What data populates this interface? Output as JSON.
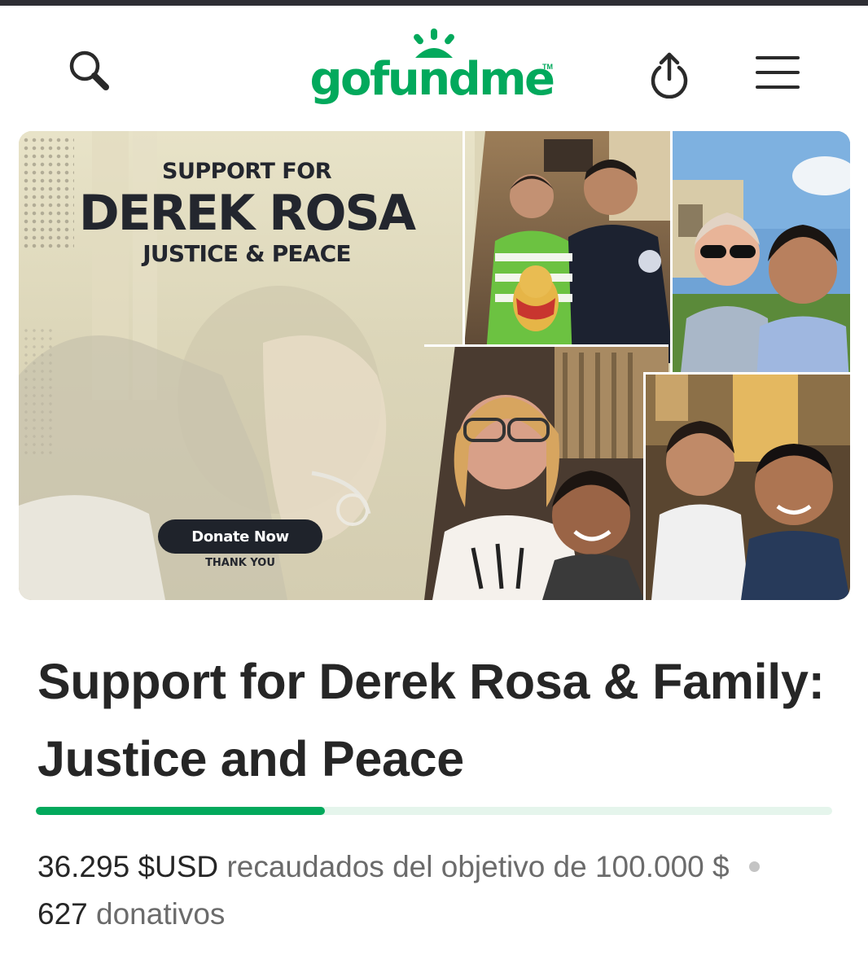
{
  "header": {
    "logo_text": "gofundme",
    "logo_tm": "TM",
    "search_icon": "search-icon",
    "share_icon": "upload-share-icon",
    "menu_icon": "hamburger-menu-icon"
  },
  "hero": {
    "line1": "SUPPORT FOR",
    "line2": "DEREK ROSA",
    "line3": "JUSTICE & PEACE",
    "donate_label": "Donate Now",
    "thanks": "THANK YOU"
  },
  "campaign": {
    "title": "Support for Derek Rosa & Family: Justice and Peace",
    "raised_amount": "36.295",
    "raised_currency": "$USD",
    "raised_text": "recaudados del objetivo de 100.000 $",
    "donations_count": "627",
    "donations_label": "donativos",
    "progress_fraction": 0.363
  },
  "colors": {
    "brand_green": "#02a95c",
    "progress_track": "#e5f5ec",
    "title_text": "#262626",
    "muted_text": "#6b6b6b"
  }
}
